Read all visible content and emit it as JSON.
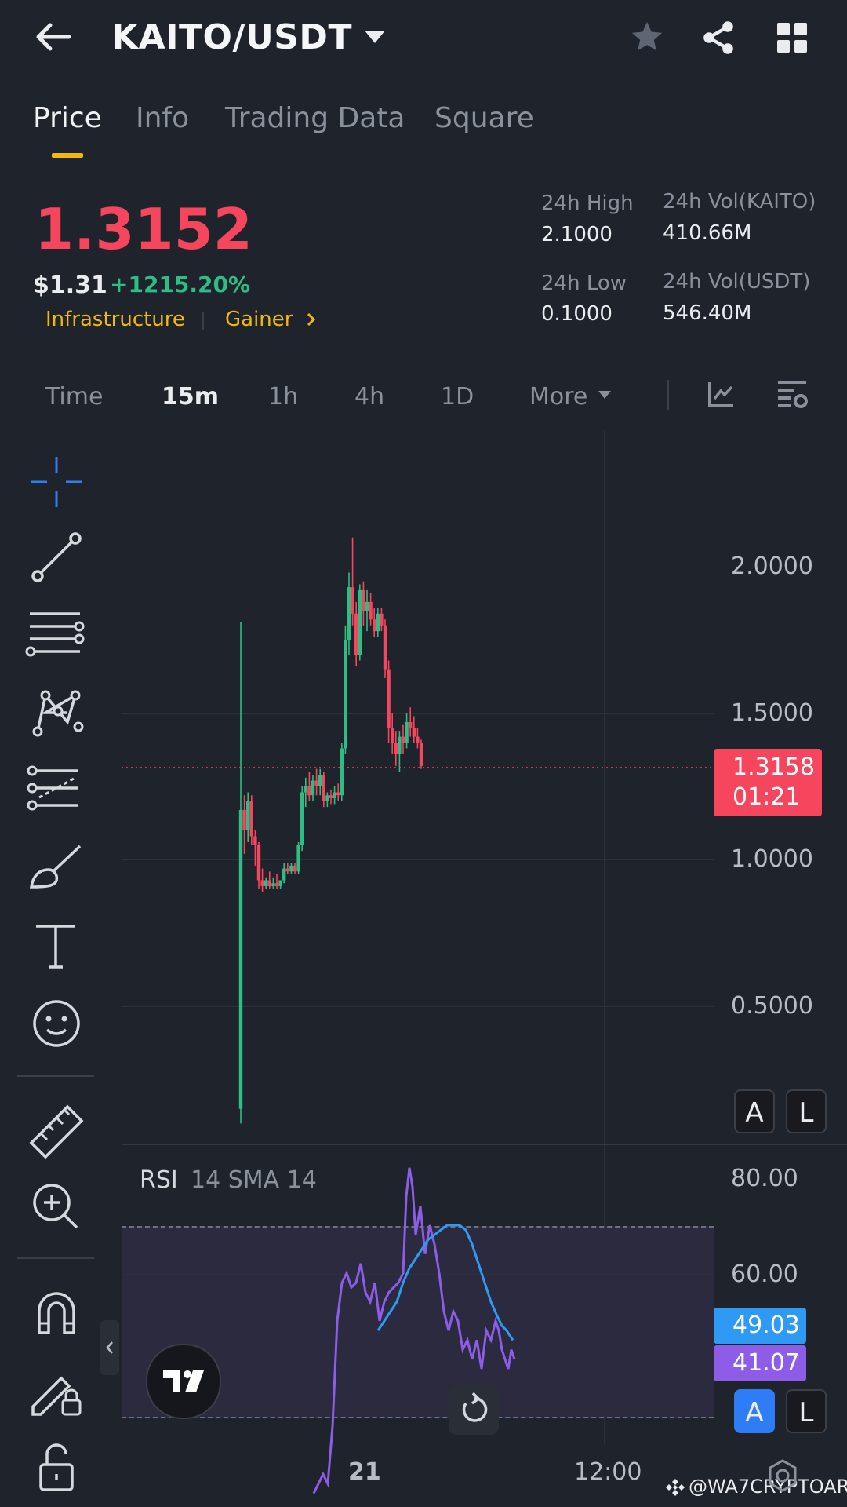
{
  "header": {
    "pair": "KAITO/USDT"
  },
  "tabs": [
    {
      "label": "Price"
    },
    {
      "label": "Info"
    },
    {
      "label": "Trading Data"
    },
    {
      "label": "Square"
    }
  ],
  "ticker": {
    "last_price": "1.3152",
    "usd_price": "$1.31",
    "change": "+1215.20%",
    "tags": [
      "Infrastructure",
      "Gainer"
    ],
    "stats": {
      "high_label": "24h High",
      "high_value": "2.1000",
      "low_label": "24h Low",
      "low_value": "0.1000",
      "vol_base_label": "24h Vol(KAITO)",
      "vol_base_value": "410.66M",
      "vol_quote_label": "24h Vol(USDT)",
      "vol_quote_value": "546.40M"
    }
  },
  "intervals": {
    "time": "Time",
    "m15": "15m",
    "h1": "1h",
    "h4": "4h",
    "d1": "1D",
    "more": "More"
  },
  "chart": {
    "price_ticks": [
      "2.0000",
      "1.5000",
      "1.0000",
      "0.5000"
    ],
    "current_price_label": "1.3158",
    "countdown": "01:21",
    "time_labels": [
      "21",
      "12:00"
    ],
    "scale_buttons": {
      "auto": "A",
      "log": "L"
    }
  },
  "rsi": {
    "label": "RSI",
    "params": "14 SMA 14",
    "ticks": [
      "80.00",
      "60.00"
    ],
    "rsi_value": "49.03",
    "sma_value": "41.07",
    "scale_buttons": {
      "auto": "A",
      "log": "L"
    }
  },
  "watermark": "@WA7CRYPTOAR",
  "colors": {
    "up": "#2ebd85",
    "down": "#f6465d",
    "accent": "#f0b90b",
    "rsi_line": "#8e5de8",
    "sma_line": "#2f9af3"
  }
}
